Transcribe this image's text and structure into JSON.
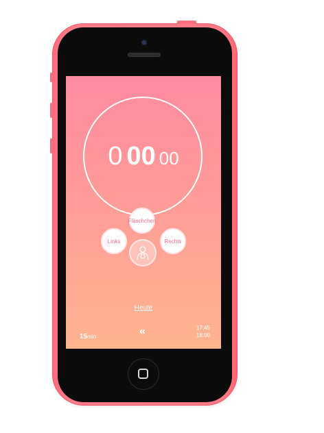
{
  "timer": {
    "hours": "0",
    "minutes": "00",
    "seconds": "00"
  },
  "options": {
    "bottle": "Fläschchen",
    "left": "Links",
    "right": "Rechts"
  },
  "center_icon": "baby-icon",
  "today_link": "Heute",
  "duration": {
    "value": "15",
    "unit": "min"
  },
  "back_icon": "double-chevron-left-icon",
  "back_glyph": "«",
  "time_range": {
    "start": "17:45",
    "end": "18:00"
  },
  "colors": {
    "phone_body": "#ff7a87",
    "gradient_top": "#ff8aa0",
    "gradient_bottom": "#ffb48f",
    "option_text": "#f16c8a"
  }
}
